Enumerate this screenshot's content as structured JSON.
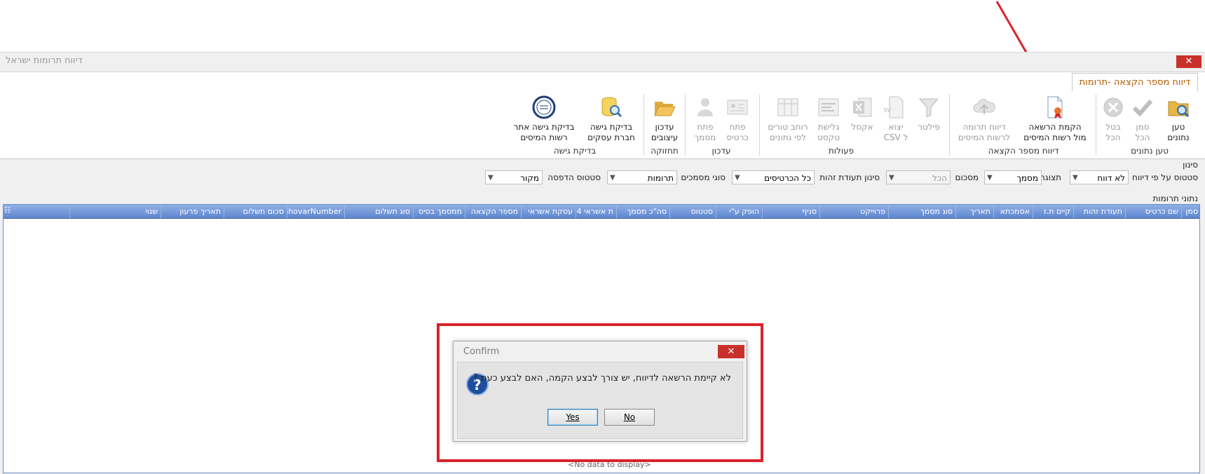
{
  "window": {
    "title": "דיווח תרומות ישראל",
    "close_glyph": "✕"
  },
  "tabs": [
    {
      "label": "דיווח מספר הקצאה -תרומות",
      "active": true
    }
  ],
  "ribbon": {
    "groups": [
      {
        "label": "טען נתונים",
        "buttons": [
          {
            "line1": "טען",
            "line2": "נתונים",
            "icon": "folder-search-icon",
            "enabled": true
          },
          {
            "line1": "סמן",
            "line2": "הכל",
            "icon": "check-icon",
            "enabled": false
          },
          {
            "line1": "בטל",
            "line2": "הכל",
            "icon": "cancel-circle-icon",
            "enabled": false
          }
        ]
      },
      {
        "label": "דיווח מספר הקצאה",
        "buttons": [
          {
            "line1": "הקמת הרשאה",
            "line2": "מול רשות המיסים",
            "icon": "certificate-document-icon",
            "enabled": true
          },
          {
            "line1": "דיווח תרומה",
            "line2": "לרשות המיסים",
            "icon": "cloud-upload-icon",
            "enabled": false
          }
        ]
      },
      {
        "label": "פעולות",
        "buttons": [
          {
            "line1": "פילטר",
            "line2": "",
            "icon": "filter-icon",
            "enabled": false
          },
          {
            "line1": "יצוא",
            "line2": "ל CSV",
            "icon": "csv-export-icon",
            "enabled": false
          },
          {
            "line1": "אקסל",
            "line2": "",
            "icon": "excel-icon",
            "enabled": false
          },
          {
            "line1": "גלישת",
            "line2": "טקסט",
            "icon": "text-wrap-icon",
            "enabled": false
          },
          {
            "line1": "רוחב טורים",
            "line2": "לפי נתונים",
            "icon": "column-width-icon",
            "enabled": false
          }
        ]
      },
      {
        "label": "עדכון",
        "buttons": [
          {
            "line1": "פתח",
            "line2": "כרטיס",
            "icon": "card-icon",
            "enabled": false
          },
          {
            "line1": "פתח",
            "line2": "מסמך",
            "icon": "person-document-icon",
            "enabled": false
          }
        ]
      },
      {
        "label": "תחזוקה",
        "buttons": [
          {
            "line1": "עדכון",
            "line2": "עיצובים",
            "icon": "folder-open-icon",
            "enabled": true
          }
        ]
      },
      {
        "label": "בדיקת גישה",
        "buttons": [
          {
            "line1": "בדיקת גישה",
            "line2": "חברת עסקים",
            "icon": "database-search-icon",
            "enabled": true
          },
          {
            "line1": "בדיקת גישה אתר",
            "line2": "רשות המיסים",
            "icon": "tax-authority-logo-icon",
            "enabled": true
          }
        ]
      }
    ]
  },
  "filter": {
    "section_label": "סינון",
    "fields": [
      {
        "label": "סטטוס על פי דיווח",
        "value": "לא דווח",
        "enabled": true
      },
      {
        "label": "תצוגה",
        "value": "מסמך",
        "enabled": true
      },
      {
        "label": "מסכום",
        "value": "הכל",
        "enabled": false
      },
      {
        "label": "סינון תעודת זהות",
        "value": "כל הכרטיסים",
        "enabled": true
      },
      {
        "label": "סוגי מסמכים",
        "value": "תרומות",
        "enabled": true
      },
      {
        "label": "סטטוס הדפסה",
        "value": "מקור",
        "enabled": true
      }
    ]
  },
  "grid": {
    "section_label": "נתוני תרומות",
    "columns": [
      "סמן",
      "שם כרטיס",
      "תעודת זהות",
      "קיים ת.ז",
      "אסמכתא",
      "תאריך",
      "סוג מסמך",
      "פרוייקט",
      "סניף",
      "הופק ע\"י",
      "סטטוס",
      "סה\"כ מסמך",
      "ת אשראי 4",
      "עסקת אשראי",
      "מספר הקצאה",
      "ממסמך בסיס",
      "סוג תשלום",
      "ShovarNumber",
      "סכום תשלום",
      "תאריך פרעון",
      "שגוי"
    ],
    "empty_text": "<No data to display>"
  },
  "dialog": {
    "title": "Confirm",
    "message": "לא קיימת הרשאה לדיווח, יש צורך לבצע הקמה, האם לבצע כעת ?",
    "icon": "question-icon",
    "yes_label": "Yes",
    "no_label": "No",
    "close_glyph": "✕"
  },
  "colors": {
    "annotation_red": "#d9232a",
    "tab_text": "#b35a00",
    "grid_header": "#5f86cf",
    "close_red": "#c9302c"
  }
}
